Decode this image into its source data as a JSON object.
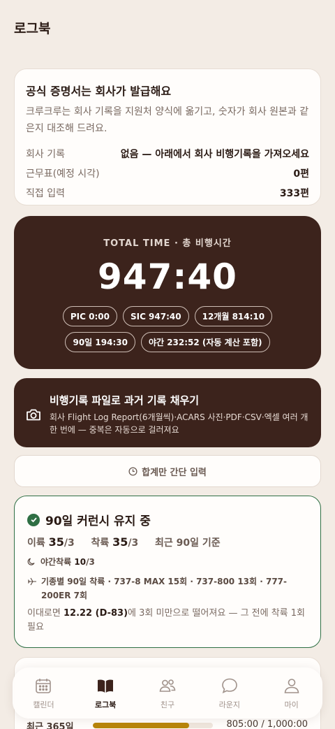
{
  "header": {
    "title": "로그북"
  },
  "cert_card": {
    "title": "공식 증명서는 회사가 발급해요",
    "description": "크루크루는 회사 기록을 지원처 양식에 옮기고, 숫자가 회사 원본과 같은지 대조해 드려요.",
    "rows": [
      {
        "label": "회사 기록",
        "value": "없음 — 아래에서 회사 비행기록을 가져오세요"
      },
      {
        "label": "근무표(예정 시각)",
        "value": "0편"
      },
      {
        "label": "직접 입력",
        "value": "333편"
      }
    ]
  },
  "total": {
    "label": "TOTAL TIME · 총 비행시간",
    "value": "947:40",
    "chips_row1": [
      "PIC 0:00",
      "SIC 947:40",
      "12개월 814:10"
    ],
    "chips_row2": [
      "90일 194:30",
      "야간 232:52 (자동 계산 포함)"
    ]
  },
  "import": {
    "icon": "camera-icon",
    "title": "비행기록 파일로 과거 기록 채우기",
    "description": "회사 Flight Log Report(6개월씩)·ACARS 사진·PDF·CSV·엑셀 여러 개 한 번에 — 중복은 자동으로 걸러져요"
  },
  "quick_entry": {
    "icon": "clock-icon",
    "label": "합계만 간단 입력"
  },
  "currency": {
    "title": "90일 커런시 유지 중",
    "takeoff_label": "이륙",
    "takeoff_value": "35",
    "takeoff_req": "/3",
    "landing_label": "착륙",
    "landing_value": "35",
    "landing_req": "/3",
    "basis": "최근 90일 기준",
    "night_label": "야간착륙",
    "night_value": "10",
    "night_req": "/3",
    "by_type": "기종별 90일 착륙 · 737-8 MAX 15회 · 737-800 13회 · 777-200ER 7회",
    "note_prefix": "이대로면 ",
    "note_date": "12.22 (D-83)",
    "note_suffix": "에 3회 미만으로 떨어져요 — 그 전에 착륙 1회 필요",
    "accent": "#2f6f44"
  },
  "year": {
    "label": "최근 365일",
    "value": "805:00 / 1,000:00",
    "progress": 0.805,
    "bar_color": "#b8860b"
  },
  "nav": {
    "items": [
      {
        "label": "캘린더",
        "icon": "calendar-icon"
      },
      {
        "label": "로그북",
        "icon": "book-icon",
        "active": true
      },
      {
        "label": "친구",
        "icon": "friends-icon"
      },
      {
        "label": "라운지",
        "icon": "chat-bubble-icon"
      },
      {
        "label": "마이",
        "icon": "person-icon"
      }
    ]
  }
}
